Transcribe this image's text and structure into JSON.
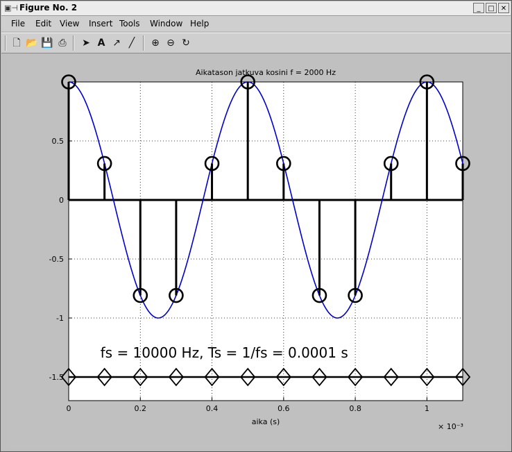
{
  "window": {
    "title": "Figure No. 2",
    "buttons": {
      "minimize": "_",
      "maximize": "□",
      "close": "✕"
    }
  },
  "menu": [
    "File",
    "Edit",
    "View",
    "Insert",
    "Tools",
    "Window",
    "Help"
  ],
  "toolbar": [
    "new-file-icon",
    "open-folder-icon",
    "save-icon",
    "print-icon",
    "select-arrow-icon",
    "text-tool-icon",
    "arrow-tool-icon",
    "line-tool-icon",
    "zoom-in-icon",
    "zoom-out-icon",
    "rotate-icon"
  ],
  "chart_data": {
    "type": "line",
    "title": "Aikatason jatkuva kosini f = 2000 Hz",
    "xlabel": "aika (s)",
    "ylabel": "",
    "x_multiplier_label": "× 10⁻³",
    "xlim": [
      0,
      0.0011
    ],
    "ylim": [
      -1.7,
      1.0
    ],
    "xticks": [
      0,
      0.0002,
      0.0004,
      0.0006,
      0.0008,
      0.001
    ],
    "xtick_labels": [
      "0",
      "0.2",
      "0.4",
      "0.6",
      "0.8",
      "1"
    ],
    "yticks": [
      -1.5,
      -1,
      -0.5,
      0,
      0.5
    ],
    "ytick_labels": [
      "-1.5",
      "-1",
      "-0.5",
      "0",
      "0.5"
    ],
    "grid": true,
    "annotation": "fs = 10000 Hz, Ts = 1/fs = 0.0001 s",
    "annotation_pos": {
      "x": 0.0001,
      "y": -1.3
    },
    "series": [
      {
        "kind": "continuous",
        "color": "#0000cc",
        "frequency_hz": 2000,
        "amplitude": 1,
        "x_start": 0,
        "x_end": 0.0011
      },
      {
        "kind": "stem",
        "color": "#000000",
        "marker": "circle",
        "x": [
          0,
          0.0001,
          0.0002,
          0.0003,
          0.0004,
          0.0005,
          0.0006,
          0.0007,
          0.0008,
          0.0009,
          0.001,
          0.0011
        ],
        "y": [
          1,
          0.309,
          -0.809,
          -0.809,
          0.309,
          1,
          0.309,
          -0.809,
          -0.809,
          0.309,
          1,
          0.309
        ]
      },
      {
        "kind": "diamond-line",
        "color": "#000000",
        "marker": "diamond",
        "y": -1.5,
        "x": [
          0,
          0.0001,
          0.0002,
          0.0003,
          0.0004,
          0.0005,
          0.0006,
          0.0007,
          0.0008,
          0.0009,
          0.001,
          0.0011
        ]
      }
    ]
  }
}
